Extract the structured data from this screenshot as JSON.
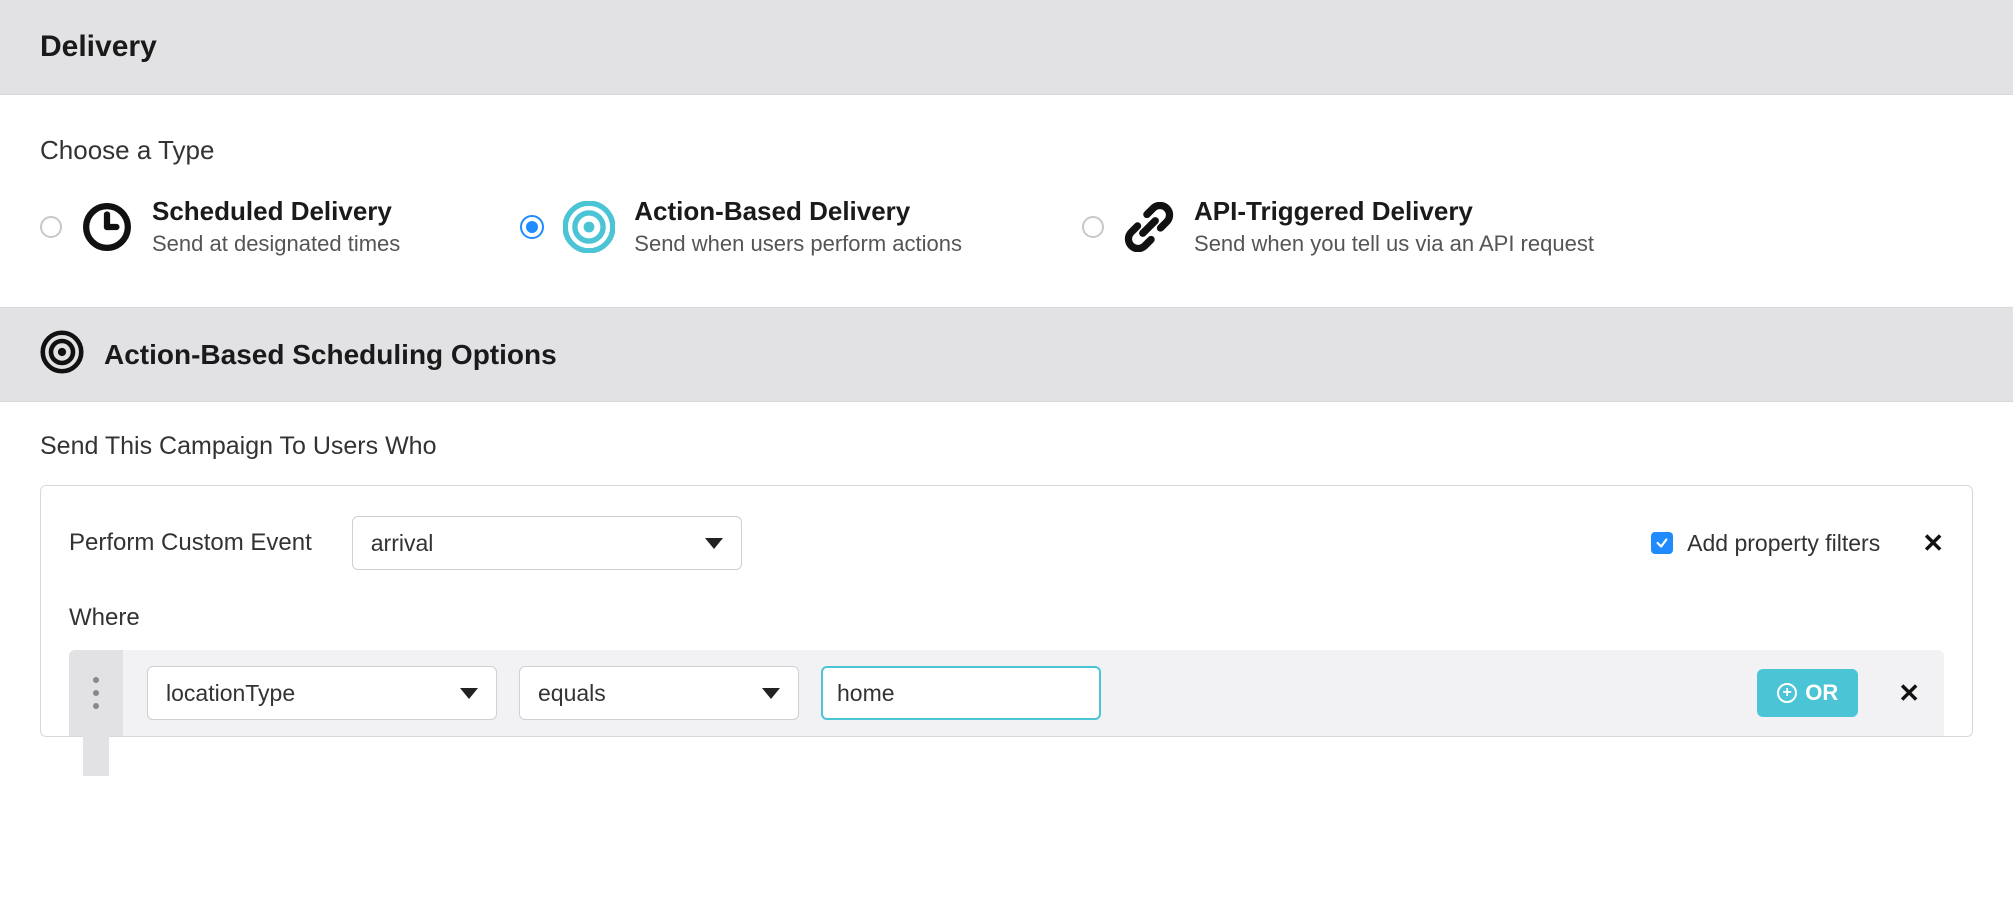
{
  "header": {
    "title": "Delivery"
  },
  "chooseType": {
    "label": "Choose a Type",
    "options": [
      {
        "title": "Scheduled Delivery",
        "desc": "Send at designated times",
        "selected": false
      },
      {
        "title": "Action-Based Delivery",
        "desc": "Send when users perform actions",
        "selected": true
      },
      {
        "title": "API-Triggered Delivery",
        "desc": "Send when you tell us via an API request",
        "selected": false
      }
    ]
  },
  "schedulingSection": {
    "title": "Action-Based Scheduling Options",
    "sendLabel": "Send This Campaign To Users Who",
    "performLabel": "Perform Custom Event",
    "eventValue": "arrival",
    "propFilterLabel": "Add property filters",
    "propFilterChecked": true,
    "whereLabel": "Where",
    "filter": {
      "field": "locationType",
      "operator": "equals",
      "value": "home"
    },
    "orLabel": "OR"
  }
}
